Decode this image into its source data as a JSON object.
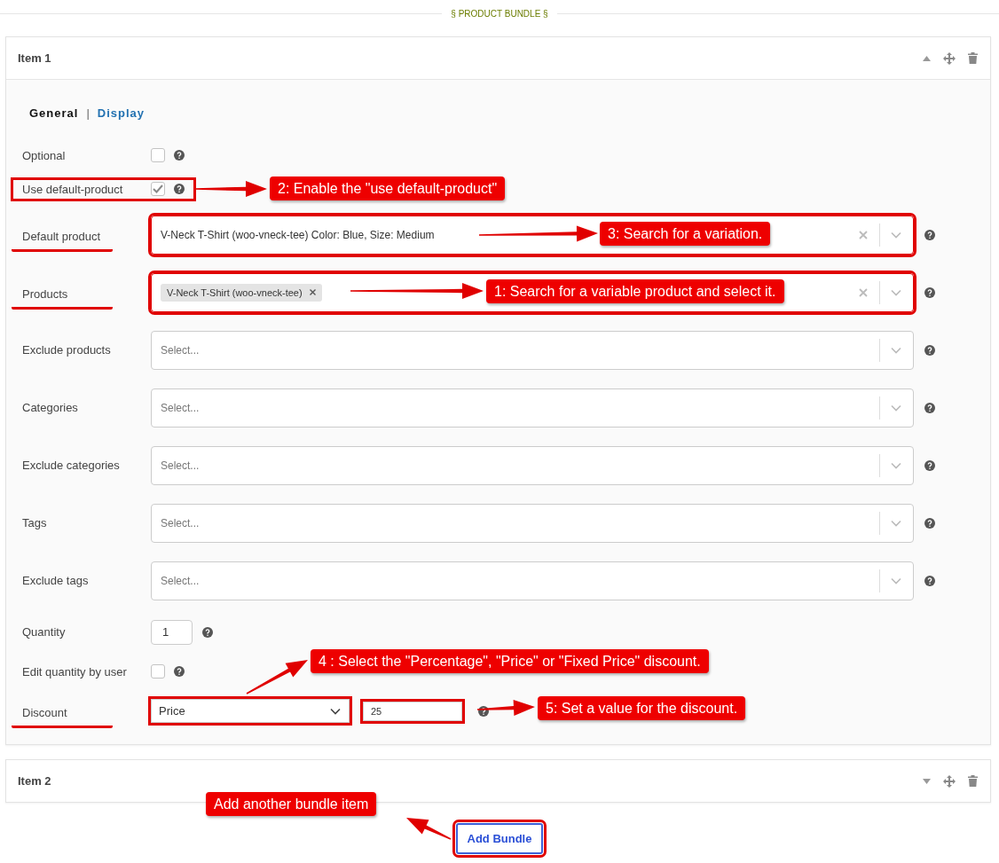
{
  "section_title": "§ PRODUCT BUNDLE §",
  "items": [
    {
      "title": "Item 1",
      "expanded": true,
      "tabs": [
        {
          "label": "General",
          "selected": true
        },
        {
          "label": "Display",
          "selected": false
        }
      ],
      "tab_separator": "|",
      "fields": [
        {
          "kind": "checkbox",
          "label": "Optional",
          "checked": false,
          "highlighted": false,
          "underlined": false
        },
        {
          "kind": "checkbox",
          "label": "Use default-product",
          "checked": true,
          "highlighted": true,
          "underlined": false
        },
        {
          "kind": "select",
          "label": "Default product",
          "value": "V-Neck T-Shirt (woo-vneck-tee) Color: Blue, Size: Medium",
          "clearable": true,
          "highlighted": true,
          "underlined": true
        },
        {
          "kind": "multiselect",
          "label": "Products",
          "tags": [
            "V-Neck T-Shirt (woo-vneck-tee)"
          ],
          "clearable": true,
          "highlighted": true,
          "underlined": true
        },
        {
          "kind": "select",
          "label": "Exclude products",
          "placeholder": "Select...",
          "clearable": false,
          "highlighted": false,
          "underlined": false
        },
        {
          "kind": "select",
          "label": "Categories",
          "placeholder": "Select...",
          "clearable": false,
          "highlighted": false,
          "underlined": false
        },
        {
          "kind": "select",
          "label": "Exclude categories",
          "placeholder": "Select...",
          "clearable": false,
          "highlighted": false,
          "underlined": false
        },
        {
          "kind": "select",
          "label": "Tags",
          "placeholder": "Select...",
          "clearable": false,
          "highlighted": false,
          "underlined": false
        },
        {
          "kind": "select",
          "label": "Exclude tags",
          "placeholder": "Select...",
          "clearable": false,
          "highlighted": false,
          "underlined": false
        },
        {
          "kind": "number",
          "label": "Quantity",
          "value": "1",
          "highlighted": false,
          "underlined": false
        },
        {
          "kind": "checkbox",
          "label": "Edit quantity by user",
          "checked": false,
          "highlighted": false,
          "underlined": false
        },
        {
          "kind": "discount",
          "label": "Discount",
          "value": "Price",
          "amount": "25",
          "highlighted": true,
          "underlined": true
        }
      ]
    },
    {
      "title": "Item 2",
      "expanded": false
    }
  ],
  "add_button": {
    "label": "Add Bundle",
    "highlighted": true
  },
  "callouts": [
    {
      "text": "2: Enable the \"use default-product\""
    },
    {
      "text": "3: Search for a variation."
    },
    {
      "text": "1: Search for a variable product and select it."
    },
    {
      "text": "4 : Select the \"Percentage\", \"Price\" or \"Fixed Price\" discount."
    },
    {
      "text": "5: Set a value for the discount."
    },
    {
      "text": "Add another bundle item"
    }
  ]
}
